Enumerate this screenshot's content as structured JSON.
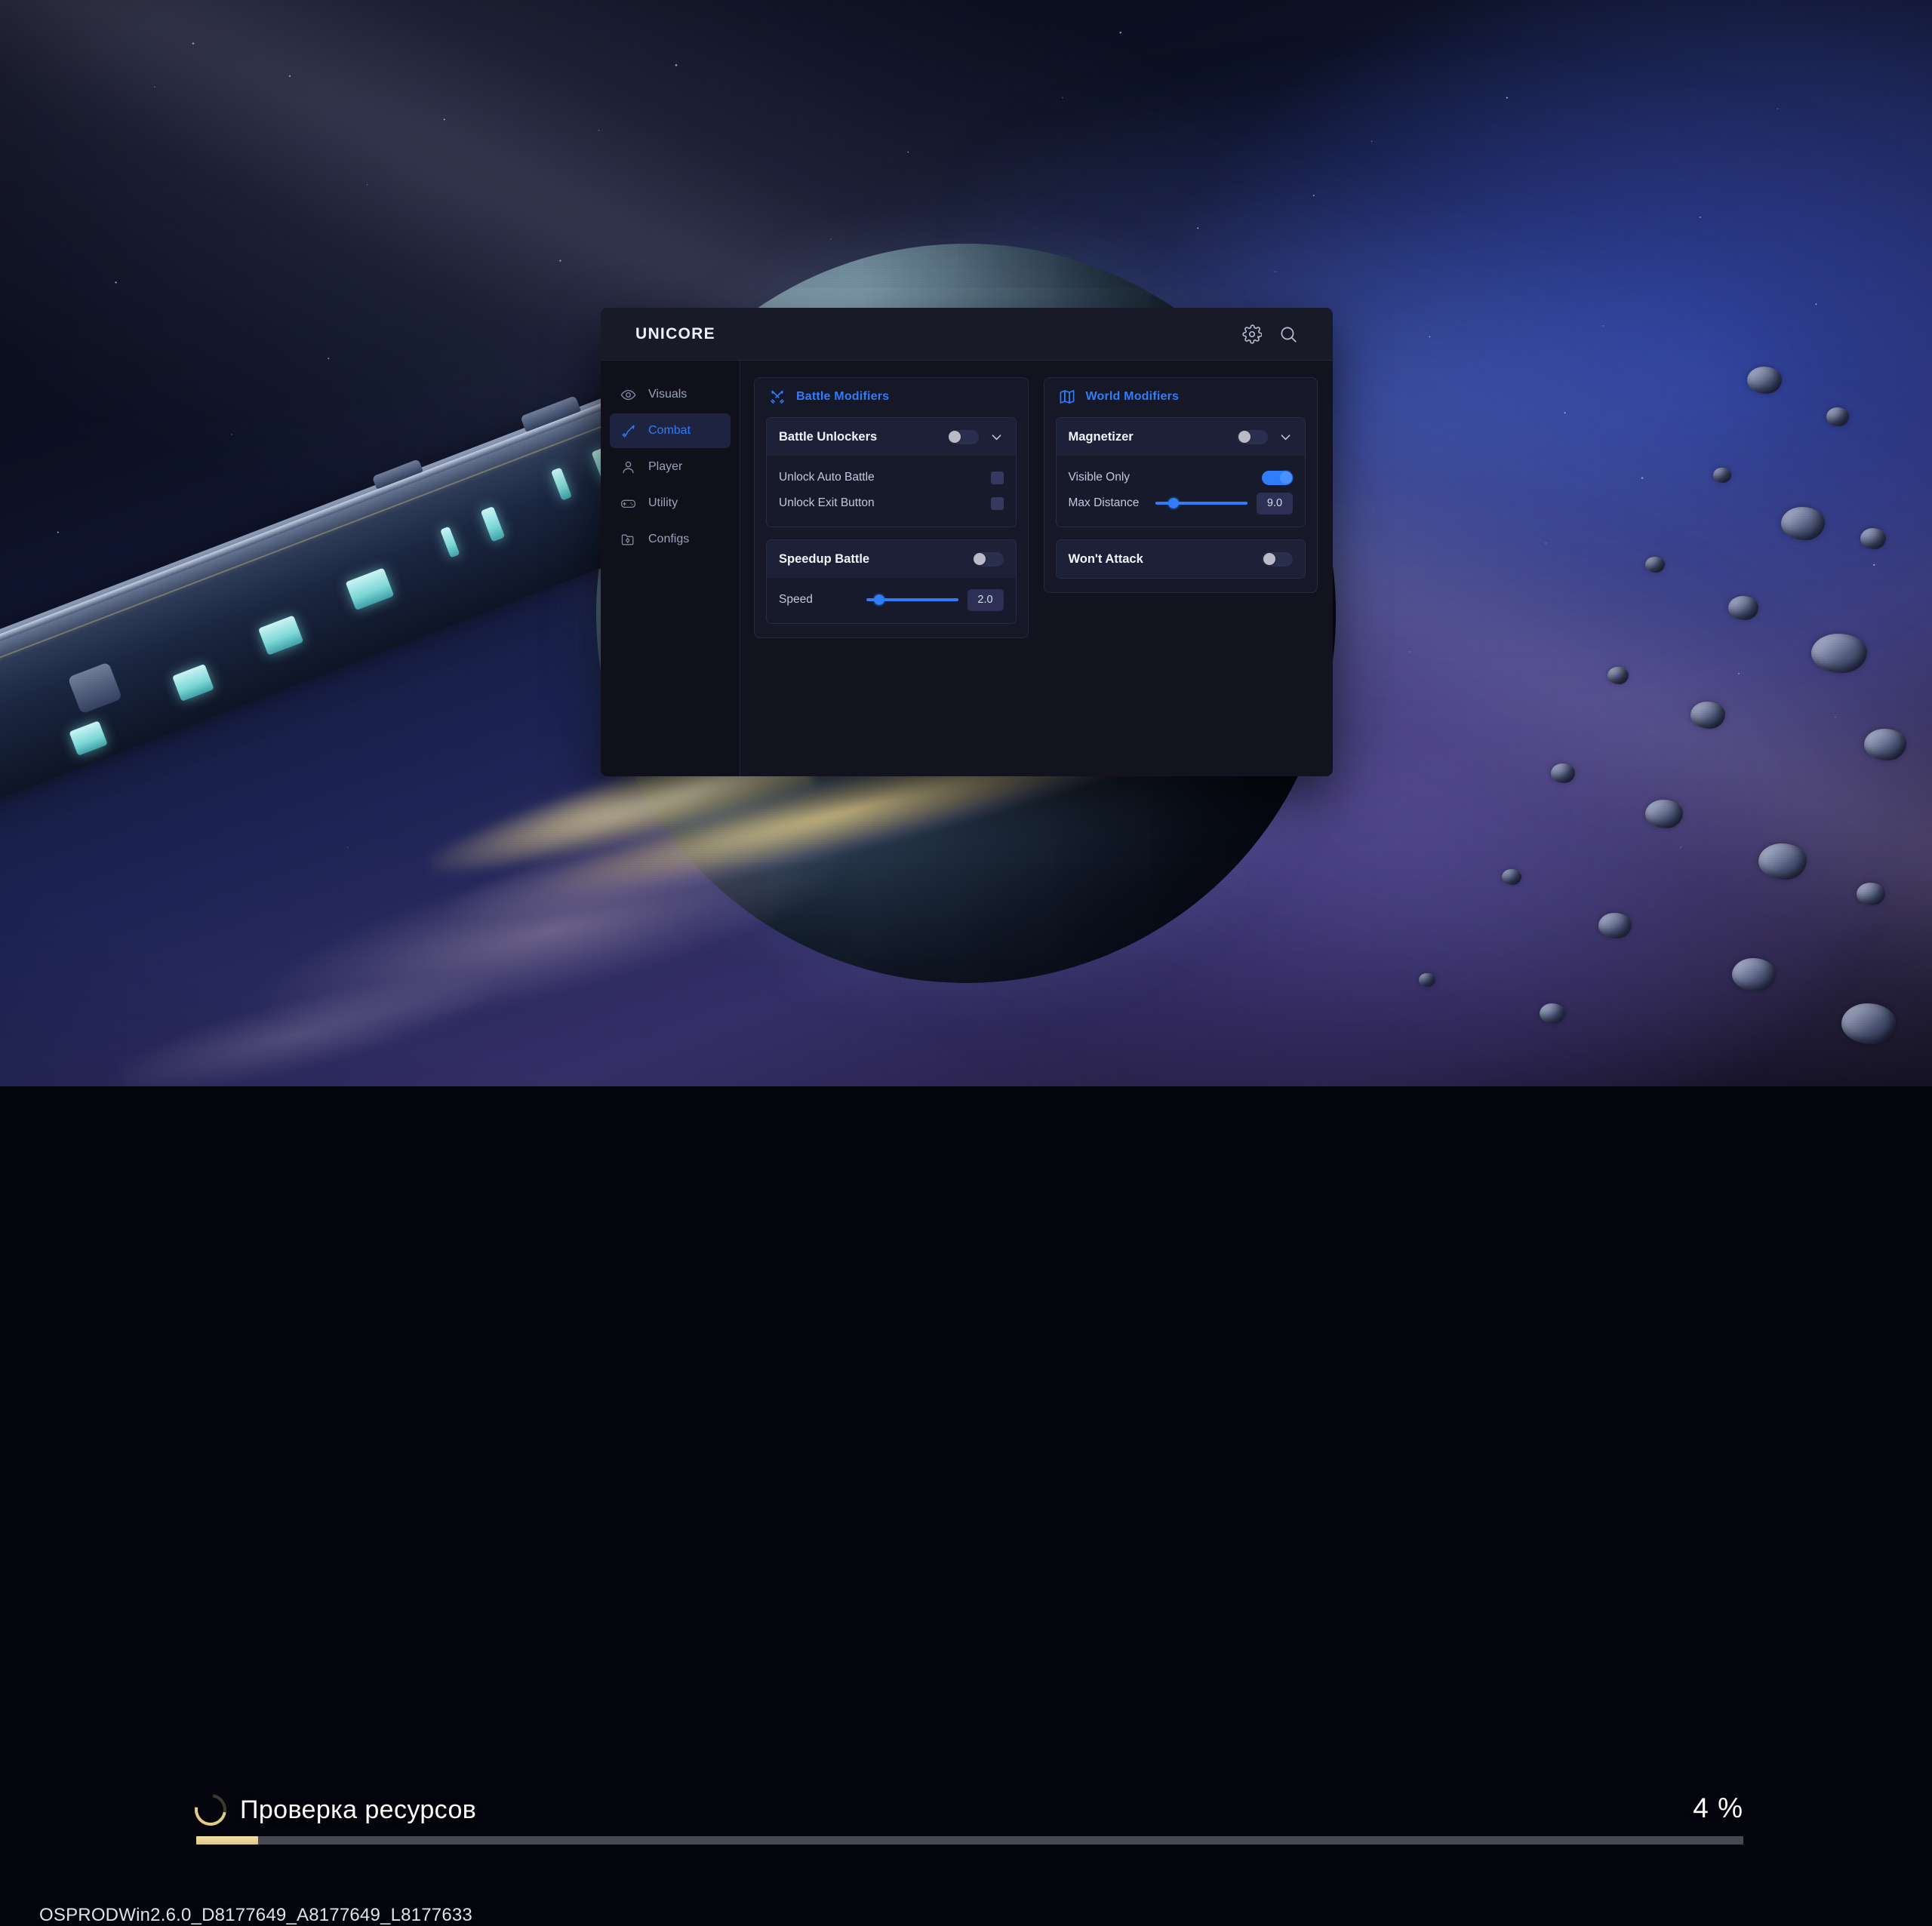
{
  "loader": {
    "status_text": "Проверка ресурсов",
    "percent_label": "4 %",
    "percent_value": 4,
    "build_version": "OSPRODWin2.6.0_D8177649_A8177649_L8177633",
    "spinner_icon": "loading-spinner-icon",
    "progress_fill_color": "#e7d092",
    "progress_track_color": "#e1e4f54d"
  },
  "panel": {
    "title": "UNICORE",
    "accent_color": "#2f7dfb",
    "header_icons": [
      {
        "name": "gear-icon",
        "label": "Settings"
      },
      {
        "name": "search-icon",
        "label": "Search"
      }
    ],
    "sidebar": {
      "items": [
        {
          "label": "Visuals",
          "icon": "eye-icon",
          "active": false
        },
        {
          "label": "Combat",
          "icon": "sword-icon",
          "active": true
        },
        {
          "label": "Player",
          "icon": "person-icon",
          "active": false
        },
        {
          "label": "Utility",
          "icon": "gamepad-icon",
          "active": false
        },
        {
          "label": "Configs",
          "icon": "folder-gear-icon",
          "active": false
        }
      ]
    },
    "columns": [
      {
        "title": "Battle Modifiers",
        "icon": "crossed-swords-icon",
        "groups": [
          {
            "title": "Battle Unlockers",
            "toggle_on": false,
            "expanded": true,
            "chevron": "chevron-down-icon",
            "rows": [
              {
                "type": "checkbox",
                "label": "Unlock Auto Battle",
                "checked": false
              },
              {
                "type": "checkbox",
                "label": "Unlock Exit Button",
                "checked": false
              }
            ]
          },
          {
            "title": "Speedup Battle",
            "toggle_on": false,
            "expanded": true,
            "chevron": "",
            "rows": [
              {
                "type": "slider",
                "label": "Speed",
                "value": "2.0",
                "fill_percent": 14
              }
            ]
          }
        ]
      },
      {
        "title": "World Modifiers",
        "icon": "map-icon",
        "groups": [
          {
            "title": "Magnetizer",
            "toggle_on": false,
            "expanded": true,
            "chevron": "chevron-down-icon",
            "rows": [
              {
                "type": "toggle",
                "label": "Visible Only",
                "on": true
              },
              {
                "type": "slider",
                "label": "Max Distance",
                "value": "9.0",
                "fill_percent": 20
              }
            ]
          },
          {
            "title": "Won't Attack",
            "toggle_on": false,
            "expanded": false,
            "chevron": "",
            "rows": []
          }
        ]
      }
    ]
  }
}
